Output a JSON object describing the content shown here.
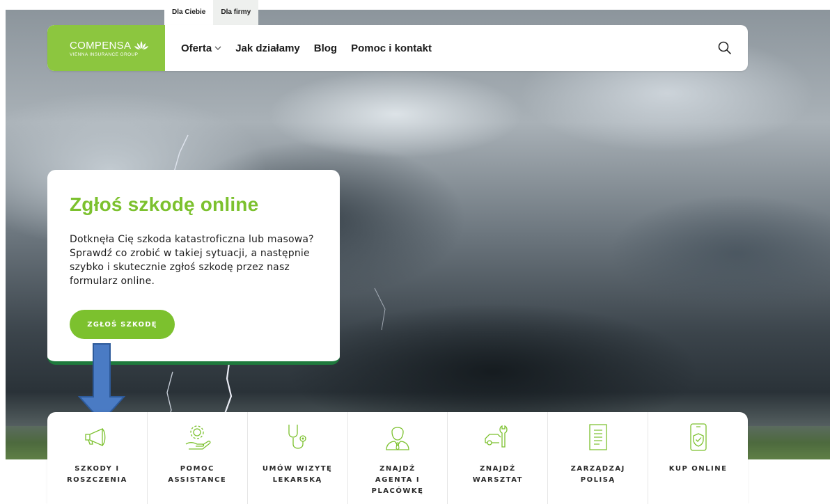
{
  "tabs": [
    {
      "label": "Dla Ciebie"
    },
    {
      "label": "Dla firmy"
    }
  ],
  "logo": {
    "brand": "COMPENSA",
    "subtitle": "VIENNA INSURANCE GROUP"
  },
  "nav": [
    {
      "label": "Oferta"
    },
    {
      "label": "Jak działamy"
    },
    {
      "label": "Blog"
    },
    {
      "label": "Pomoc i kontakt"
    }
  ],
  "hero": {
    "title": "Zgłoś szkodę online",
    "text": "Dotknęła Cię szkoda katastroficzna lub masowa? Sprawdź co zrobić w takiej sytuacji, a następnie szybko i skutecznie zgłoś szkodę przez nasz formularz online.",
    "cta": "ZGŁOŚ SZKODĘ"
  },
  "tiles": [
    {
      "label": "SZKODY I ROSZCZENIA",
      "icon": "megaphone-icon"
    },
    {
      "label": "POMOC ASSISTANCE",
      "icon": "gear-hand-icon"
    },
    {
      "label": "UMÓW WIZYTĘ LEKARSKĄ",
      "icon": "stethoscope-icon"
    },
    {
      "label": "ZNAJDŹ AGENTA I PLACÓWKĘ",
      "icon": "agent-icon"
    },
    {
      "label": "ZNAJDŹ WARSZTAT",
      "icon": "car-wrench-icon"
    },
    {
      "label": "ZARZĄDZAJ POLISĄ",
      "icon": "document-icon"
    },
    {
      "label": "KUP ONLINE",
      "icon": "phone-shield-icon"
    }
  ],
  "colors": {
    "brand_green": "#8cc63f",
    "accent_green": "#7cc12e",
    "dark_green": "#1f7a3d",
    "arrow_blue": "#4a7bc4"
  }
}
